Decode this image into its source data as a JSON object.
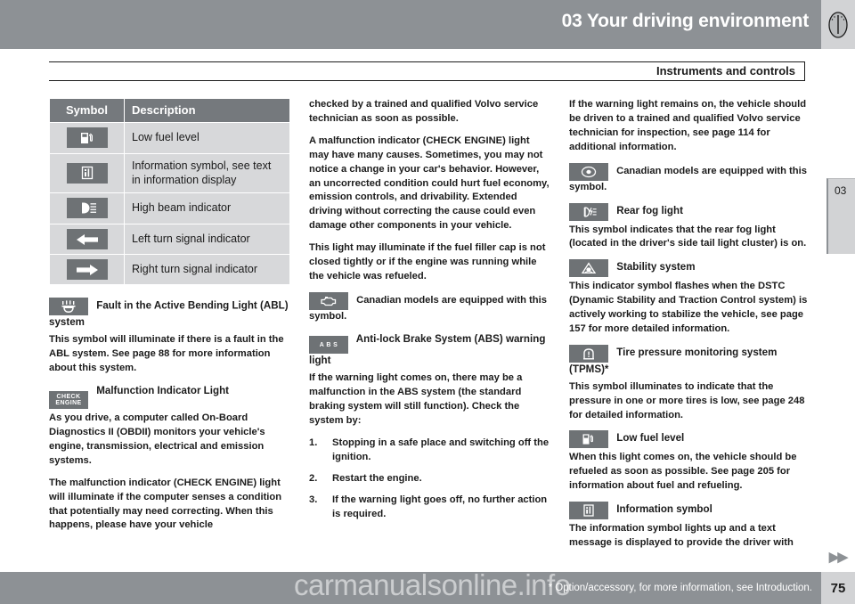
{
  "header": {
    "title": "03 Your driving environment",
    "icon": "gauge-icon",
    "bg_color": "#8d9195"
  },
  "section": {
    "title": "Instruments and controls"
  },
  "chapter_tab": {
    "number": "03"
  },
  "symbol_table": {
    "columns": [
      "Symbol",
      "Description"
    ],
    "rows": [
      {
        "icon": "fuel-pump-icon",
        "description": "Low fuel level"
      },
      {
        "icon": "information-icon",
        "description": "Information symbol, see text in information display"
      },
      {
        "icon": "high-beam-icon",
        "description": "High beam indicator"
      },
      {
        "icon": "left-arrow-icon",
        "description": "Left turn signal indicator"
      },
      {
        "icon": "right-arrow-icon",
        "description": "Right turn signal indicator"
      }
    ]
  },
  "column_1": {
    "ahl": {
      "icon": "ahl-headlight-icon",
      "heading": "Fault in the Active Bending Light (ABL) system",
      "body": "This symbol will illuminate if there is a fault in the ABL system. See page 88 for more information about this system."
    },
    "mil": {
      "icon": "check-engine-icon",
      "icon_text_line1": "CHECK",
      "icon_text_line2": "ENGINE",
      "heading": "Malfunction Indicator Light",
      "body_1": "As you drive, a computer called On-Board Diagnostics II (OBDII) monitors your vehicle's engine, transmission, electrical and emission systems.",
      "body_2": "The malfunction indicator (CHECK ENGINE) light will illuminate if the computer senses a condition that potentially may need correcting. When this happens, please have your vehicle"
    }
  },
  "column_2": {
    "para_1": "checked by a trained and qualified Volvo service technician as soon as possible.",
    "para_2": "A malfunction indicator (CHECK ENGINE) light may have many causes. Sometimes, you may not notice a change in your car's behavior. However, an uncorrected condition could hurt fuel economy, emission controls, and drivability. Extended driving without correcting the cause could even damage other components in your vehicle.",
    "para_3": "This light may illuminate if the fuel filler cap is not closed tightly or if the engine was running while the vehicle was refueled.",
    "canadian": {
      "icon": "canada-engine-icon",
      "body": "Canadian models are equipped with this symbol."
    },
    "abs": {
      "icon": "abs-icon",
      "icon_text": "A B S",
      "heading": "Anti-lock Brake System (ABS) warning light",
      "body": "If the warning light comes on, there may be a malfunction in the ABS system (the standard braking system will still function). Check the system by:",
      "steps": [
        "Stopping in a safe place and switching off the ignition.",
        "Restart the engine.",
        "If the warning light goes off, no further action is required."
      ]
    }
  },
  "column_3": {
    "para_1": "If the warning light remains on, the vehicle should be driven to a trained and qualified Volvo service technician for inspection, see page 114 for additional information.",
    "canadian": {
      "icon": "canada-oval-icon",
      "body": "Canadian models are equipped with this symbol."
    },
    "rear_fog": {
      "icon": "rear-fog-light-icon",
      "heading": "Rear fog light",
      "body": "This symbol indicates that the rear fog light (located in the driver's side tail light cluster) is on."
    },
    "stability": {
      "icon": "stability-system-icon",
      "heading": "Stability system",
      "body": "This indicator symbol flashes when the DSTC (Dynamic Stability and Traction Control system) is actively working to stabilize the vehicle, see page 157 for more detailed information."
    },
    "tpms": {
      "icon": "tire-pressure-icon",
      "heading": "Tire pressure monitoring system (TPMS)*",
      "body": "This symbol illuminates to indicate that the pressure in one or more tires is low, see page 248 for detailed information."
    },
    "low_fuel": {
      "icon": "fuel-pump-icon",
      "heading": "Low fuel level",
      "body": "When this light comes on, the vehicle should be refueled as soon as possible. See page 205 for information about fuel and refueling."
    },
    "information": {
      "icon": "information-icon",
      "heading": "Information symbol",
      "body": "The information symbol lights up and a text message is displayed to provide the driver with"
    }
  },
  "footer": {
    "note": "* Option/accessory, for more information, see Introduction.",
    "page_number": "75",
    "next_arrows": "▶▶",
    "watermark": "carmanualsonline.info"
  }
}
